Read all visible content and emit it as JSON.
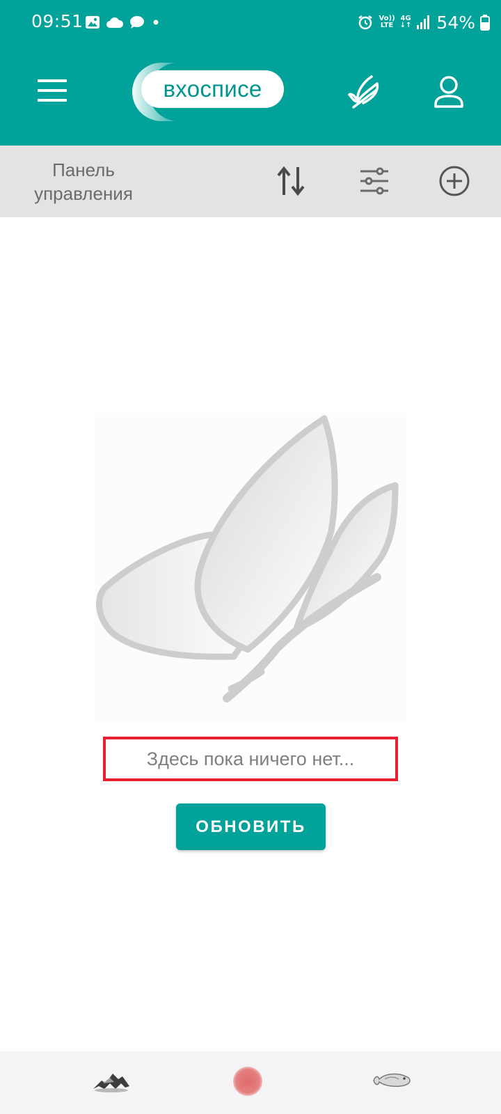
{
  "status_bar": {
    "time": "09:51",
    "network_volte": "Vo))",
    "network_lte": "LTE",
    "network_4g": "4G",
    "battery_percent": "54%",
    "icons": [
      "gallery-icon",
      "cloud-icon",
      "chat-icon",
      "dot-icon",
      "alarm-icon",
      "signal-icon",
      "battery-icon"
    ]
  },
  "app_bar": {
    "logo_text": "вхосписе",
    "icons": [
      "menu-icon",
      "feather-icon",
      "user-icon"
    ]
  },
  "toolbar": {
    "title_line1": "Панель",
    "title_line2": "управления",
    "icons": [
      "sort-icon",
      "filter-sliders-icon",
      "add-circle-icon"
    ]
  },
  "empty_state": {
    "message": "Здесь пока ничего нет...",
    "refresh_label": "ОБНОВИТЬ",
    "illustration": "feather-illustration"
  },
  "bottom_bar": {
    "icons": [
      "mountain-icon",
      "red-dot-icon",
      "fish-icon"
    ]
  },
  "colors": {
    "brand": "#00a29a",
    "toolbar_bg": "#e3e3e3",
    "highlight_border": "#e8202f"
  }
}
